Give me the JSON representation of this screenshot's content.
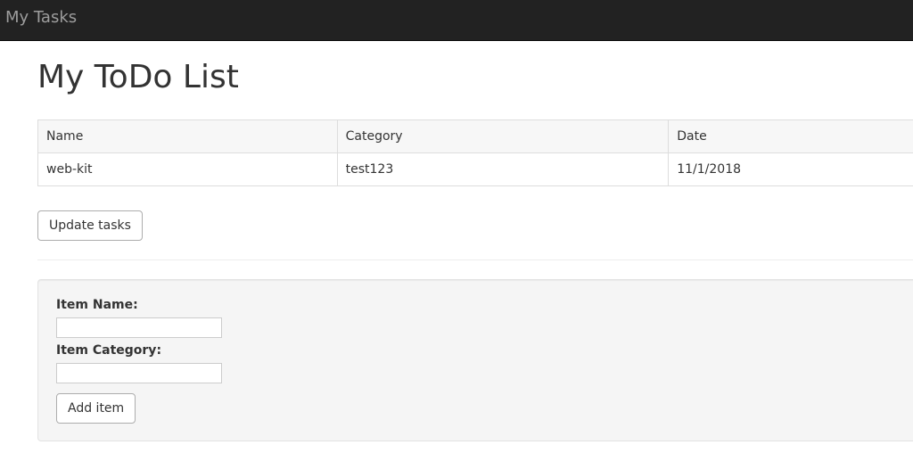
{
  "navbar": {
    "brand": "My Tasks"
  },
  "page": {
    "title": "My ToDo List"
  },
  "table": {
    "headers": [
      "Name",
      "Category",
      "Date"
    ],
    "rows": [
      [
        "web-kit",
        "test123",
        "11/1/2018"
      ]
    ]
  },
  "actions": {
    "update_label": "Update tasks"
  },
  "form": {
    "name_label": "Item Name:",
    "name_value": "",
    "category_label": "Item Category:",
    "category_value": "",
    "add_label": "Add item"
  },
  "colors": {
    "navbar_bg": "#222222",
    "navbar_text": "#9d9d9d",
    "well_bg": "#f5f5f5"
  }
}
